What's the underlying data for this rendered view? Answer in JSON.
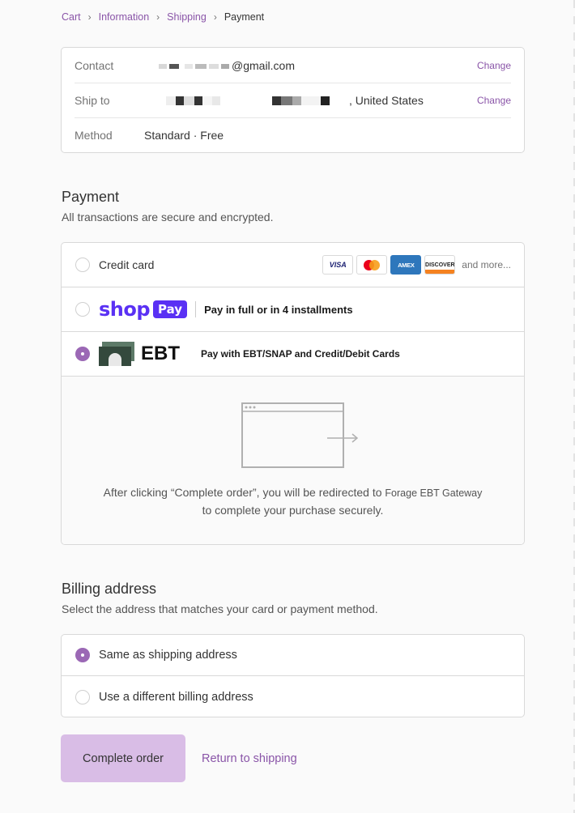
{
  "breadcrumb": {
    "items": [
      "Cart",
      "Information",
      "Shipping"
    ],
    "current": "Payment"
  },
  "review": {
    "contact_label": "Contact",
    "contact_value": "@gmail.com",
    "ship_label": "Ship to",
    "ship_value": ", United States",
    "method_label": "Method",
    "method_value": "Standard · Free",
    "change_label": "Change"
  },
  "payment": {
    "heading": "Payment",
    "subtext": "All transactions are secure and encrypted.",
    "credit_card_label": "Credit card",
    "card_brands": [
      "VISA",
      "AMEX",
      "DISCOVER"
    ],
    "and_more": "and more...",
    "shop_logo": "shop",
    "shop_pay_badge": "Pay",
    "shop_pay_text": "Pay in full or in 4 installments",
    "ebt_word": "EBT",
    "ebt_text": "Pay with EBT/SNAP and Credit/Debit Cards",
    "redirect_line1": "After clicking “Complete order”, you will be redirected to",
    "redirect_gateway": "Forage EBT Gateway",
    "redirect_line2": "to complete your purchase securely.",
    "selected": "ebt"
  },
  "billing": {
    "heading": "Billing address",
    "subtext": "Select the address that matches your card or payment method.",
    "same_label": "Same as shipping address",
    "different_label": "Use a different billing address",
    "selected": "same"
  },
  "actions": {
    "complete_label": "Complete order",
    "return_label": "Return to shipping"
  },
  "colors": {
    "accent": "#8a55a8",
    "radio_selected": "#9b68b5",
    "button_bg": "#d9bde6",
    "shop_pay": "#5a31f4",
    "ebt_green": "#3d5a4b"
  }
}
